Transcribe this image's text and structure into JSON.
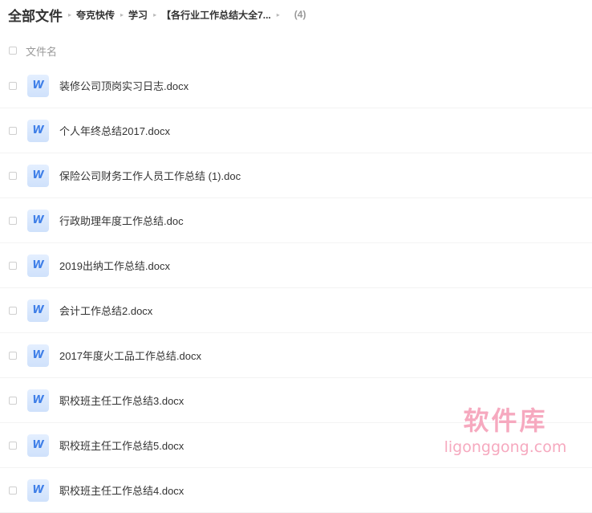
{
  "breadcrumb": {
    "root": "全部文件",
    "items": [
      "夸克快传",
      "学习",
      "【各行业工作总结大全7..."
    ],
    "separator": "▸",
    "count": "(4)"
  },
  "list_header": {
    "column_label": "文件名"
  },
  "files": [
    {
      "name": "装修公司顶岗实习日志.docx",
      "icon": "word-doc-icon"
    },
    {
      "name": "个人年终总结2017.docx",
      "icon": "word-doc-icon"
    },
    {
      "name": "保险公司财务工作人员工作总结 (1).doc",
      "icon": "word-doc-icon"
    },
    {
      "name": "行政助理年度工作总结.doc",
      "icon": "word-doc-icon"
    },
    {
      "name": "2019出纳工作总结.docx",
      "icon": "word-doc-icon"
    },
    {
      "name": "会计工作总结2.docx",
      "icon": "word-doc-icon"
    },
    {
      "name": "2017年度火工品工作总结.docx",
      "icon": "word-doc-icon"
    },
    {
      "name": "职校班主任工作总结3.docx",
      "icon": "word-doc-icon"
    },
    {
      "name": "职校班主任工作总结5.docx",
      "icon": "word-doc-icon"
    },
    {
      "name": "职校班主任工作总结4.docx",
      "icon": "word-doc-icon"
    }
  ],
  "icon_glyph": "W",
  "watermark": {
    "title": "软件库",
    "subtitle": "ligonggong.com"
  },
  "colors": {
    "word_icon": "#3f7fe8",
    "watermark": "#f6a9bf"
  }
}
